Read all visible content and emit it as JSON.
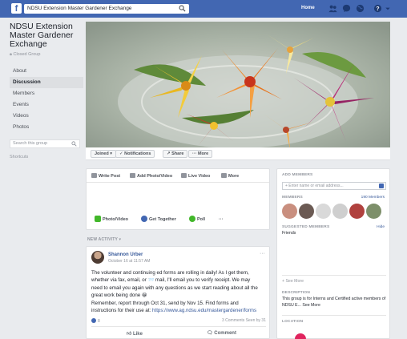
{
  "topbar": {
    "logo": "f",
    "search_text": "NDSU Extension Master Gardener Exchange",
    "home_label": "Home",
    "icons": [
      "search-icon",
      "friends-icon",
      "messenger-icon",
      "globe-icon",
      "help-icon",
      "dropdown-icon"
    ]
  },
  "group": {
    "name": "NDSU Extension Master Gardener Exchange",
    "privacy": "Closed Group"
  },
  "nav": [
    {
      "label": "About"
    },
    {
      "label": "Discussion"
    },
    {
      "label": "Members"
    },
    {
      "label": "Events"
    },
    {
      "label": "Videos"
    },
    {
      "label": "Photos"
    }
  ],
  "group_search": {
    "placeholder": "Search this group"
  },
  "shortcuts_label": "Shortcuts",
  "action_bar": {
    "joined": "Joined ▾",
    "notifications": "✓ Notifications",
    "share": "↗ Share",
    "more": "··· More"
  },
  "composer": {
    "tabs": [
      "Write Post",
      "Add Photo/Video",
      "Live Video",
      "More"
    ],
    "pills": [
      "Photo/Video",
      "Get Together",
      "Poll",
      "···"
    ]
  },
  "feed_label": "NEW ACTIVITY ▾",
  "post": {
    "author": "Shannon Urber",
    "time": "October 16 at 11:57 AM",
    "more": "···",
    "body_lines": [
      "The volunteer and continuing ed forms are rolling in daily! As I get them,",
      "whether via fax, email, or 📨 mail, I'll email you to verify receipt. We may",
      "need to email you again with any questions as we start reading about all the",
      "great work being done 😀",
      "Remember, report through Oct 31, send by Nov 15. Find forms and"
    ],
    "instructions_prefix": "instructions for their use at:",
    "instructions_link": "https://www.ag.ndsu.edu/mastergardener/forms",
    "likes": "8",
    "stats": "3 Comments  Seen by 31",
    "like_label": "Like",
    "comment_label": "Comment"
  },
  "sidebar": {
    "add_members_heading": "ADD MEMBERS",
    "add_members_placeholder": "+ Enter name or email address...",
    "members_heading": "MEMBERS",
    "members_count": "190 Members",
    "suggested_heading": "SUGGESTED MEMBERS",
    "hide_label": "Hide",
    "suggested_type": "Friends",
    "see_more": "+ See More",
    "description_heading": "DESCRIPTION",
    "description": "This group is for Interns and Certified active members of NDSU E... See More",
    "location_heading": "LOCATION",
    "avatar_colors": [
      "#c98f7f",
      "#6b5a53",
      "#d9d9d9",
      "#cfcfcf",
      "#b0413e",
      "#7d8f6a"
    ]
  },
  "colors": {
    "brand": "#4267b2",
    "link": "#365899",
    "background": "#e9ebee"
  }
}
